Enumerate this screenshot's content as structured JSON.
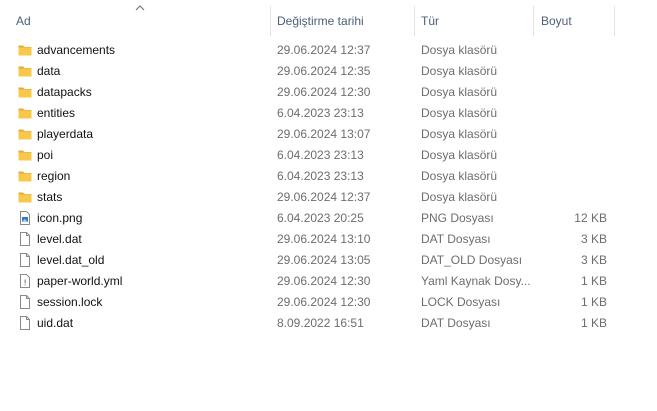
{
  "columns": {
    "name": "Ad",
    "date": "Değiştirme tarihi",
    "type": "Tür",
    "size": "Boyut"
  },
  "colors": {
    "folder": "#f8c84a",
    "folder_tab": "#e8a93a",
    "header_text": "#4c607a",
    "secondary_text": "#6d6d6d"
  },
  "files": [
    {
      "name": "advancements",
      "date": "29.06.2024 12:37",
      "type": "Dosya klasörü",
      "size": "",
      "icon": "folder-icon"
    },
    {
      "name": "data",
      "date": "29.06.2024 12:35",
      "type": "Dosya klasörü",
      "size": "",
      "icon": "folder-icon"
    },
    {
      "name": "datapacks",
      "date": "29.06.2024 12:30",
      "type": "Dosya klasörü",
      "size": "",
      "icon": "folder-icon"
    },
    {
      "name": "entities",
      "date": "6.04.2023 23:13",
      "type": "Dosya klasörü",
      "size": "",
      "icon": "folder-icon"
    },
    {
      "name": "playerdata",
      "date": "29.06.2024 13:07",
      "type": "Dosya klasörü",
      "size": "",
      "icon": "folder-icon"
    },
    {
      "name": "poi",
      "date": "6.04.2023 23:13",
      "type": "Dosya klasörü",
      "size": "",
      "icon": "folder-icon"
    },
    {
      "name": "region",
      "date": "6.04.2023 23:13",
      "type": "Dosya klasörü",
      "size": "",
      "icon": "folder-icon"
    },
    {
      "name": "stats",
      "date": "29.06.2024 12:37",
      "type": "Dosya klasörü",
      "size": "",
      "icon": "folder-icon"
    },
    {
      "name": "icon.png",
      "date": "6.04.2023 20:25",
      "type": "PNG Dosyası",
      "size": "12 KB",
      "icon": "image-file-icon"
    },
    {
      "name": "level.dat",
      "date": "29.06.2024 13:10",
      "type": "DAT Dosyası",
      "size": "3 KB",
      "icon": "file-icon"
    },
    {
      "name": "level.dat_old",
      "date": "29.06.2024 13:05",
      "type": "DAT_OLD Dosyası",
      "size": "3 KB",
      "icon": "file-icon"
    },
    {
      "name": "paper-world.yml",
      "date": "29.06.2024 12:30",
      "type": "Yaml Kaynak Dosy...",
      "size": "1 KB",
      "icon": "script-file-icon"
    },
    {
      "name": "session.lock",
      "date": "29.06.2024 12:30",
      "type": "LOCK Dosyası",
      "size": "1 KB",
      "icon": "file-icon"
    },
    {
      "name": "uid.dat",
      "date": "8.09.2022 16:51",
      "type": "DAT Dosyası",
      "size": "1 KB",
      "icon": "file-icon"
    }
  ]
}
